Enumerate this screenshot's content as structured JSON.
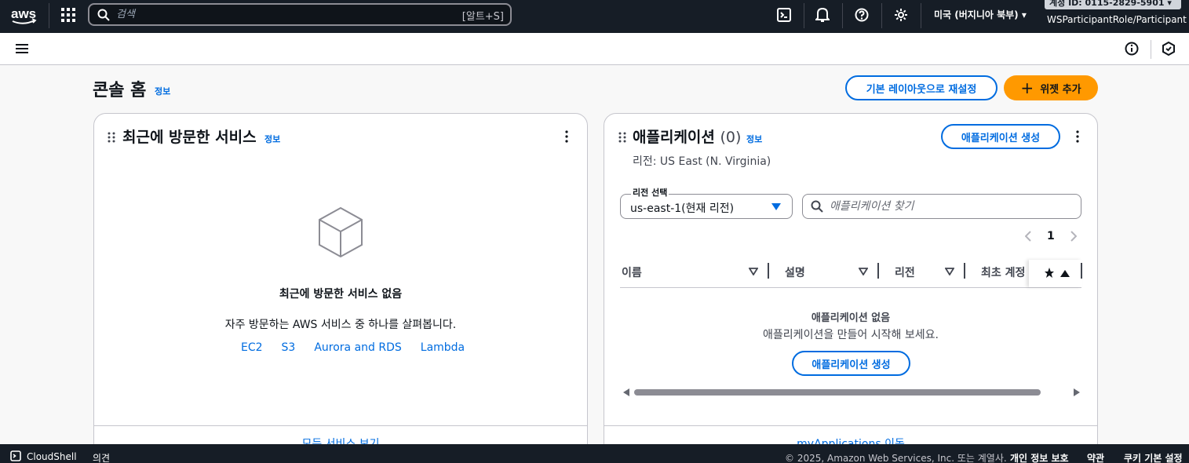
{
  "topnav": {
    "search_placeholder": "검색",
    "search_shortcut": "[알트+S]",
    "region": "미국 (버지니아 북부) ▾",
    "account": "계정 ID: 0115-2829-5901 ▾",
    "role": "WSParticipantRole/Participant"
  },
  "page": {
    "title": "콘솔 홈",
    "info": "정보",
    "reset_layout": "기본 레이아웃으로 재설정",
    "add_widget": "위젯 추가"
  },
  "recent": {
    "title": "최근에 방문한 서비스",
    "info": "정보",
    "empty_title": "최근에 방문한 서비스 없음",
    "empty_desc": "자주 방문하는 AWS 서비스 중 하나를 살펴봅니다.",
    "links": [
      "EC2",
      "S3",
      "Aurora and RDS",
      "Lambda"
    ],
    "footer": "모든 서비스 보기"
  },
  "apps": {
    "title": "애플리케이션",
    "count": "(0)",
    "info": "정보",
    "create": "애플리케이션 생성",
    "region_label": "리전: US East (N. Virginia)",
    "select_label": "리전 선택",
    "select_value": "us-east-1(현재 리전)",
    "filter_placeholder": "애플리케이션 찾기",
    "page_num": "1",
    "columns": [
      "이름",
      "설명",
      "리전",
      "최초 계정"
    ],
    "empty_title": "애플리케이션 없음",
    "empty_desc": "애플리케이션을 만들어 시작해 보세요.",
    "empty_create": "애플리케이션 생성",
    "footer": "myApplications 이동"
  },
  "bottombar": {
    "cloudshell": "CloudShell",
    "feedback": "의견",
    "copyright": "© 2025, Amazon Web Services, Inc. 또는 계열사.",
    "privacy": "개인 정보 보호",
    "terms": "약관",
    "cookies": "쿠키 기본 설정"
  }
}
